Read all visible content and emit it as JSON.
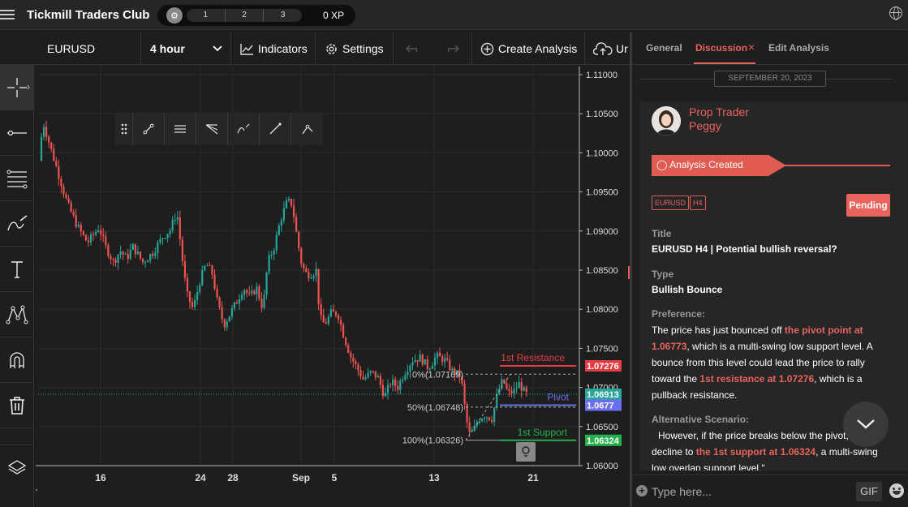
{
  "app": {
    "title": "Tickmill Traders Club",
    "xp_levels": [
      "1",
      "2",
      "3"
    ],
    "xp_label": "0 XP"
  },
  "toolbar": {
    "symbol": "EURUSD",
    "interval": "4 hour",
    "indicators_label": "Indicators",
    "settings_label": "Settings",
    "create_label": "Create Analysis",
    "upload_label": "Ur"
  },
  "chart_data": {
    "type": "candlestick",
    "symbol": "EURUSD",
    "timeframe": "H4",
    "y_ticks": [
      "1.11000",
      "1.10500",
      "1.10000",
      "1.09500",
      "1.09000",
      "1.08500",
      "1.08000",
      "1.07500",
      "1.07000",
      "1.06500",
      "1.06000"
    ],
    "ylim": [
      1.06,
      1.11
    ],
    "x_ticks": [
      "16",
      "24",
      "28",
      "Sep",
      "5",
      "13",
      "21"
    ],
    "path": [
      [
        0,
        1.099
      ],
      [
        5,
        1.104
      ],
      [
        12,
        1.1015
      ],
      [
        22,
        1.098
      ],
      [
        35,
        1.0935
      ],
      [
        48,
        1.0905
      ],
      [
        60,
        1.0885
      ],
      [
        74,
        1.0905
      ],
      [
        82,
        1.088
      ],
      [
        92,
        1.086
      ],
      [
        100,
        1.0875
      ],
      [
        108,
        1.0865
      ],
      [
        116,
        1.088
      ],
      [
        128,
        1.086
      ],
      [
        140,
        1.0872
      ],
      [
        152,
        1.0892
      ],
      [
        162,
        1.0902
      ],
      [
        170,
        1.0925
      ],
      [
        176,
        1.087
      ],
      [
        182,
        1.082
      ],
      [
        190,
        1.08
      ],
      [
        198,
        1.0835
      ],
      [
        206,
        1.0858
      ],
      [
        214,
        1.0845
      ],
      [
        220,
        1.0808
      ],
      [
        228,
        1.078
      ],
      [
        236,
        1.0795
      ],
      [
        244,
        1.081
      ],
      [
        252,
        1.0828
      ],
      [
        260,
        1.0815
      ],
      [
        268,
        1.0828
      ],
      [
        276,
        1.08
      ],
      [
        282,
        1.086
      ],
      [
        290,
        1.088
      ],
      [
        298,
        1.0915
      ],
      [
        306,
        1.0938
      ],
      [
        312,
        1.0935
      ],
      [
        318,
        1.0892
      ],
      [
        324,
        1.0856
      ],
      [
        330,
        1.0845
      ],
      [
        336,
        1.0845
      ],
      [
        342,
        1.085
      ],
      [
        346,
        1.079
      ],
      [
        352,
        1.078
      ],
      [
        360,
        1.0795
      ],
      [
        368,
        1.0795
      ],
      [
        376,
        1.0765
      ],
      [
        384,
        1.074
      ],
      [
        392,
        1.0725
      ],
      [
        400,
        1.071
      ],
      [
        410,
        1.072
      ],
      [
        418,
        1.0712
      ],
      [
        426,
        1.0688
      ],
      [
        434,
        1.0708
      ],
      [
        442,
        1.07
      ],
      [
        450,
        1.0718
      ],
      [
        460,
        1.0735
      ],
      [
        470,
        1.0738
      ],
      [
        480,
        1.0725
      ],
      [
        490,
        1.074
      ],
      [
        500,
        1.0735
      ],
      [
        510,
        1.072
      ],
      [
        520,
        1.0715
      ],
      [
        526,
        1.0665
      ],
      [
        530,
        1.064
      ],
      [
        535,
        1.0643
      ],
      [
        542,
        1.066
      ],
      [
        550,
        1.0665
      ],
      [
        558,
        1.066
      ],
      [
        566,
        1.0695
      ],
      [
        572,
        1.071
      ],
      [
        578,
        1.0692
      ],
      [
        585,
        1.0695
      ],
      [
        592,
        1.0705
      ],
      [
        600,
        1.0691
      ]
    ],
    "levels": [
      {
        "label": "1st Resistance",
        "value": 1.07276,
        "color": "#e23e44"
      },
      {
        "label": "Pivot",
        "value": 1.06773,
        "color": "#6b6ef0"
      },
      {
        "label": "1st Support",
        "value": 1.06324,
        "color": "#26b04d"
      }
    ],
    "fib": [
      {
        "label": "0%(1.07169)",
        "value": 1.07169
      },
      {
        "label": "50%(1.06748)",
        "value": 1.06748
      },
      {
        "label": "100%(1.06326)",
        "value": 1.06326
      }
    ],
    "price_tags": [
      {
        "text": "1.07276",
        "value": 1.07276,
        "color": "#e23e44"
      },
      {
        "text": "1.06913",
        "value": 1.06913,
        "color": "#27a69a"
      },
      {
        "text": "1.0677",
        "value": 1.06773,
        "color": "#6b6ef0"
      },
      {
        "text": "1.06324",
        "value": 1.06324,
        "color": "#26b04d"
      }
    ]
  },
  "panel": {
    "tabs": {
      "general": "General",
      "discussion": "Discussion",
      "edit": "Edit Analysis"
    },
    "date": "SEPTEMBER 20, 2023",
    "author_line1": "Prop Trader",
    "author_line2": "Peggy",
    "ribbon": "Analysis Created",
    "tag1": "EURUSD",
    "tag2": "H4",
    "status": "Pending",
    "title_label": "Title",
    "title_value": "EURUSD H4 | Potential bullish reversal?",
    "type_label": "Type",
    "type_value": "Bullish Bounce",
    "pref_label": "Preference:",
    "pref_1": "The price has just bounced off ",
    "pref_hl1": "the pivot point at 1.06773",
    "pref_2": ", which is a multi-swing low support level. A bounce from this level could lead the price to rally toward the ",
    "pref_hl2": "1st resistance at 1.07276",
    "pref_3": ", which is a pullback resistance.",
    "alt_label": "Alternative Scenario:",
    "alt_1": "However, if the price breaks below the pivot, ",
    "alt_2": "decline to ",
    "alt_hl": "the 1st support at 1.06324",
    "alt_3": ", a multi-swing",
    "alt_4": "low overlap support level.\"",
    "input_placeholder": "Type here...",
    "gif": "GIF"
  }
}
